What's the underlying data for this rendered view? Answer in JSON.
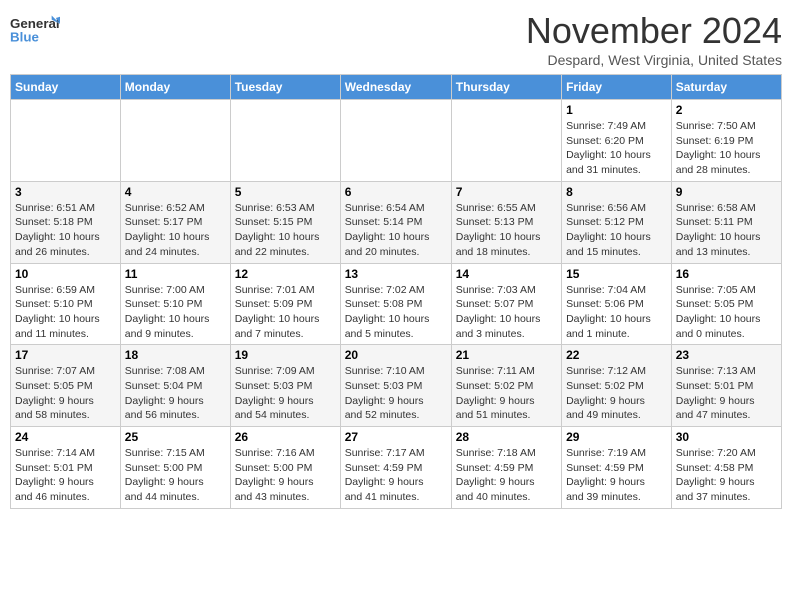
{
  "header": {
    "logo_line1": "General",
    "logo_line2": "Blue",
    "month": "November 2024",
    "location": "Despard, West Virginia, United States"
  },
  "weekdays": [
    "Sunday",
    "Monday",
    "Tuesday",
    "Wednesday",
    "Thursday",
    "Friday",
    "Saturday"
  ],
  "weeks": [
    [
      {
        "day": "",
        "info": ""
      },
      {
        "day": "",
        "info": ""
      },
      {
        "day": "",
        "info": ""
      },
      {
        "day": "",
        "info": ""
      },
      {
        "day": "",
        "info": ""
      },
      {
        "day": "1",
        "info": "Sunrise: 7:49 AM\nSunset: 6:20 PM\nDaylight: 10 hours\nand 31 minutes."
      },
      {
        "day": "2",
        "info": "Sunrise: 7:50 AM\nSunset: 6:19 PM\nDaylight: 10 hours\nand 28 minutes."
      }
    ],
    [
      {
        "day": "3",
        "info": "Sunrise: 6:51 AM\nSunset: 5:18 PM\nDaylight: 10 hours\nand 26 minutes."
      },
      {
        "day": "4",
        "info": "Sunrise: 6:52 AM\nSunset: 5:17 PM\nDaylight: 10 hours\nand 24 minutes."
      },
      {
        "day": "5",
        "info": "Sunrise: 6:53 AM\nSunset: 5:15 PM\nDaylight: 10 hours\nand 22 minutes."
      },
      {
        "day": "6",
        "info": "Sunrise: 6:54 AM\nSunset: 5:14 PM\nDaylight: 10 hours\nand 20 minutes."
      },
      {
        "day": "7",
        "info": "Sunrise: 6:55 AM\nSunset: 5:13 PM\nDaylight: 10 hours\nand 18 minutes."
      },
      {
        "day": "8",
        "info": "Sunrise: 6:56 AM\nSunset: 5:12 PM\nDaylight: 10 hours\nand 15 minutes."
      },
      {
        "day": "9",
        "info": "Sunrise: 6:58 AM\nSunset: 5:11 PM\nDaylight: 10 hours\nand 13 minutes."
      }
    ],
    [
      {
        "day": "10",
        "info": "Sunrise: 6:59 AM\nSunset: 5:10 PM\nDaylight: 10 hours\nand 11 minutes."
      },
      {
        "day": "11",
        "info": "Sunrise: 7:00 AM\nSunset: 5:10 PM\nDaylight: 10 hours\nand 9 minutes."
      },
      {
        "day": "12",
        "info": "Sunrise: 7:01 AM\nSunset: 5:09 PM\nDaylight: 10 hours\nand 7 minutes."
      },
      {
        "day": "13",
        "info": "Sunrise: 7:02 AM\nSunset: 5:08 PM\nDaylight: 10 hours\nand 5 minutes."
      },
      {
        "day": "14",
        "info": "Sunrise: 7:03 AM\nSunset: 5:07 PM\nDaylight: 10 hours\nand 3 minutes."
      },
      {
        "day": "15",
        "info": "Sunrise: 7:04 AM\nSunset: 5:06 PM\nDaylight: 10 hours\nand 1 minute."
      },
      {
        "day": "16",
        "info": "Sunrise: 7:05 AM\nSunset: 5:05 PM\nDaylight: 10 hours\nand 0 minutes."
      }
    ],
    [
      {
        "day": "17",
        "info": "Sunrise: 7:07 AM\nSunset: 5:05 PM\nDaylight: 9 hours\nand 58 minutes."
      },
      {
        "day": "18",
        "info": "Sunrise: 7:08 AM\nSunset: 5:04 PM\nDaylight: 9 hours\nand 56 minutes."
      },
      {
        "day": "19",
        "info": "Sunrise: 7:09 AM\nSunset: 5:03 PM\nDaylight: 9 hours\nand 54 minutes."
      },
      {
        "day": "20",
        "info": "Sunrise: 7:10 AM\nSunset: 5:03 PM\nDaylight: 9 hours\nand 52 minutes."
      },
      {
        "day": "21",
        "info": "Sunrise: 7:11 AM\nSunset: 5:02 PM\nDaylight: 9 hours\nand 51 minutes."
      },
      {
        "day": "22",
        "info": "Sunrise: 7:12 AM\nSunset: 5:02 PM\nDaylight: 9 hours\nand 49 minutes."
      },
      {
        "day": "23",
        "info": "Sunrise: 7:13 AM\nSunset: 5:01 PM\nDaylight: 9 hours\nand 47 minutes."
      }
    ],
    [
      {
        "day": "24",
        "info": "Sunrise: 7:14 AM\nSunset: 5:01 PM\nDaylight: 9 hours\nand 46 minutes."
      },
      {
        "day": "25",
        "info": "Sunrise: 7:15 AM\nSunset: 5:00 PM\nDaylight: 9 hours\nand 44 minutes."
      },
      {
        "day": "26",
        "info": "Sunrise: 7:16 AM\nSunset: 5:00 PM\nDaylight: 9 hours\nand 43 minutes."
      },
      {
        "day": "27",
        "info": "Sunrise: 7:17 AM\nSunset: 4:59 PM\nDaylight: 9 hours\nand 41 minutes."
      },
      {
        "day": "28",
        "info": "Sunrise: 7:18 AM\nSunset: 4:59 PM\nDaylight: 9 hours\nand 40 minutes."
      },
      {
        "day": "29",
        "info": "Sunrise: 7:19 AM\nSunset: 4:59 PM\nDaylight: 9 hours\nand 39 minutes."
      },
      {
        "day": "30",
        "info": "Sunrise: 7:20 AM\nSunset: 4:58 PM\nDaylight: 9 hours\nand 37 minutes."
      }
    ]
  ]
}
